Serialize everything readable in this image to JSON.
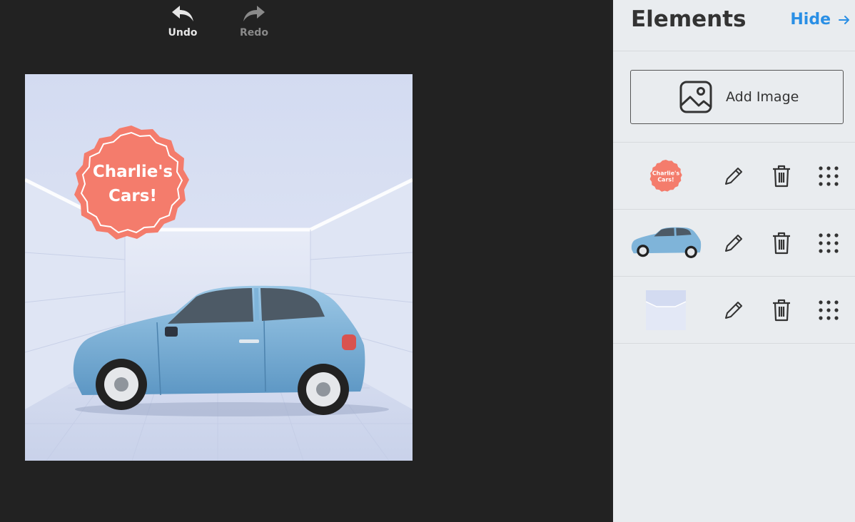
{
  "toolbar": {
    "undo_label": "Undo",
    "redo_label": "Redo"
  },
  "canvas": {
    "badge_line1": "Charlie's",
    "badge_line2": "Cars!",
    "badge_color": "#f47c6c",
    "car_color": "#7fb4d9"
  },
  "panel": {
    "title": "Elements",
    "hide_label": "Hide",
    "hide_icon": "arrow-right-icon",
    "add_image_label": "Add Image",
    "add_image_icon": "image-icon",
    "layers": [
      {
        "name": "badge-layer",
        "thumb_text_1": "Charlie's",
        "thumb_text_2": "Cars!"
      },
      {
        "name": "car-layer"
      },
      {
        "name": "background-layer"
      }
    ],
    "row_icons": [
      "pencil-icon",
      "trash-icon",
      "drag-handle-icon"
    ]
  },
  "colors": {
    "accent": "#2a8fe5",
    "editor_bg": "#222222",
    "panel_bg": "#e9ecef"
  }
}
